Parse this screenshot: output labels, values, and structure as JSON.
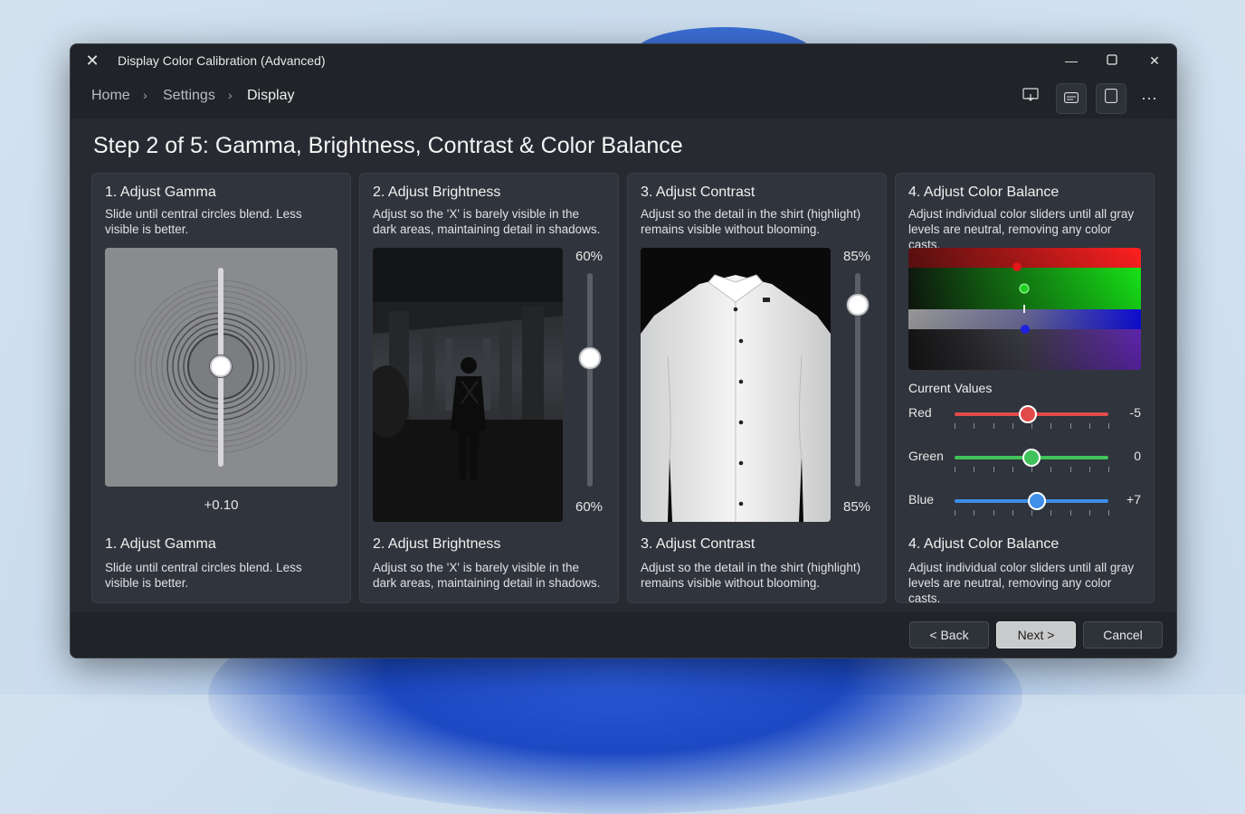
{
  "window": {
    "title": "Display Color Calibration (Advanced)"
  },
  "breadcrumb": {
    "items": [
      "Home",
      "Settings",
      "Display"
    ],
    "separator": "›"
  },
  "toolbar_icons": [
    "cast-screen-icon",
    "subtitles-icon",
    "tablet-icon",
    "more-icon"
  ],
  "step_title": "Step 2 of 5: Gamma, Brightness, Contrast & Color Balance",
  "cards": {
    "gamma": {
      "title": "1. Adjust Gamma",
      "description": "Slide until central circles blend. Less visible is better.",
      "value": "+0.10",
      "footer_title": "1. Adjust Gamma",
      "footer_description": "Slide until central circles blend. Less visible is better."
    },
    "brightness": {
      "title": "2. Adjust Brightness",
      "description": "Adjust so the 'X' is barely visible in the dark areas, maintaining detail in shadows.",
      "top_value": "60%",
      "bottom_value": "60%",
      "level": 0.6,
      "footer_title": "2. Adjust Brightness",
      "footer_description": "Adjust so the 'X' is barely visible in the dark areas, maintaining detail in shadows."
    },
    "contrast": {
      "title": "3. Adjust Contrast",
      "description": "Adjust so the detail in the shirt (highlight) remains visible without blooming.",
      "top_value": "85%",
      "bottom_value": "85%",
      "level": 0.85,
      "footer_title": "3. Adjust Contrast",
      "footer_description": "Adjust so the detail in the shirt (highlight) remains visible without blooming."
    },
    "color_balance": {
      "title": "4. Adjust Color Balance",
      "description": "Adjust individual color sliders until all gray levels are neutral, removing any color casts.",
      "current_values_label": "Current Values",
      "sliders": [
        {
          "label": "Red",
          "value": "-5",
          "color": "#e24a4a"
        },
        {
          "label": "Green",
          "value": "0",
          "color": "#3fc35a"
        },
        {
          "label": "Blue",
          "value": "+7",
          "color": "#3d8fe8"
        }
      ],
      "footer_title": "4. Adjust Color Balance",
      "footer_description": "Adjust individual color sliders until all gray levels are neutral, removing any color casts."
    }
  },
  "footer": {
    "back": "< Back",
    "next": "Next >",
    "cancel": "Cancel"
  },
  "colors": {
    "window_bg": "#202328",
    "card_bg": "#30343c",
    "accent_next": "#c9cacc"
  }
}
